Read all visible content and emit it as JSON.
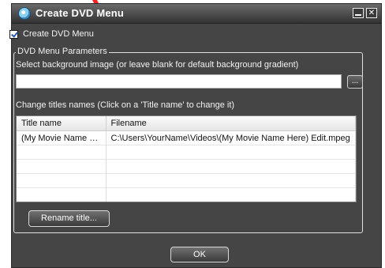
{
  "window": {
    "title": "Create DVD Menu"
  },
  "controls": {
    "minimize_glyph": "",
    "close_glyph": "✕"
  },
  "create_menu_checkbox": {
    "label": "Create DVD Menu",
    "checked": true
  },
  "params": {
    "legend": "DVD Menu Parameters",
    "bg_label": "Select background image (or leave blank for default background gradient)",
    "bg_value": "",
    "browse_label": "...",
    "titles_label": "Change titles names (Click on a 'Title name' to change it)"
  },
  "table": {
    "headers": [
      "Title name",
      "Filename"
    ],
    "rows": [
      [
        "(My Movie Name Her...",
        "C:\\Users\\YourName\\Videos\\(My Movie Name Here) Edit.mpeg"
      ],
      [
        "",
        ""
      ],
      [
        "",
        ""
      ],
      [
        "",
        ""
      ],
      [
        "",
        ""
      ]
    ]
  },
  "rename_button": "Rename title...",
  "ok_button": "OK",
  "colors": {
    "window_bg": "#454545",
    "accent_arrow": "#ff2020"
  }
}
